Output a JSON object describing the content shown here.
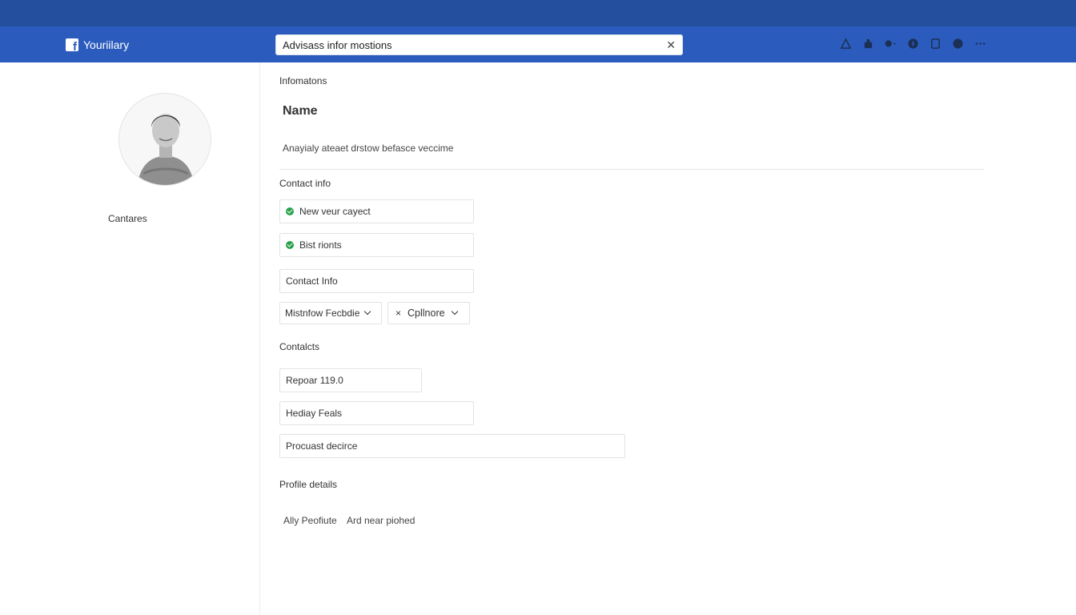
{
  "app": {
    "brand": "Youriilary"
  },
  "search": {
    "value": "Advisass infor mostions"
  },
  "nav_icons": [
    "alert-icon",
    "thumbs-icon",
    "chat-icon",
    "help-icon",
    "clipboard-icon",
    "notification-icon",
    "more-icon"
  ],
  "sidebar": {
    "label": "Cantares"
  },
  "main": {
    "section_title": "Infomatons",
    "name_heading": "Name",
    "description": "Anayialy ateaet drstow befasce veccime",
    "contact_info_label": "Contact info",
    "contact_fields": [
      {
        "text": "New veur cayect",
        "checked": true
      },
      {
        "text": "Bist rionts",
        "checked": true
      }
    ],
    "contact_input_placeholder": "Contact Info",
    "dropdowns": [
      {
        "label": "Mistnfow Fecbdie"
      },
      {
        "label": "Cpllnore",
        "prefix": "×"
      }
    ],
    "contacts_label": "Contalcts",
    "contacts_fields": [
      {
        "value": "Repoar 119.0"
      },
      {
        "value": "Hediay Feals"
      },
      {
        "value": "Procuast decirce"
      }
    ],
    "profile_details_label": "Profile details",
    "profile_links": [
      "Ally Peofiute",
      "Ard near piohed"
    ]
  },
  "colors": {
    "topstrip": "#244f9e",
    "navbar": "#2b5cbd",
    "check": "#2aa14b"
  }
}
